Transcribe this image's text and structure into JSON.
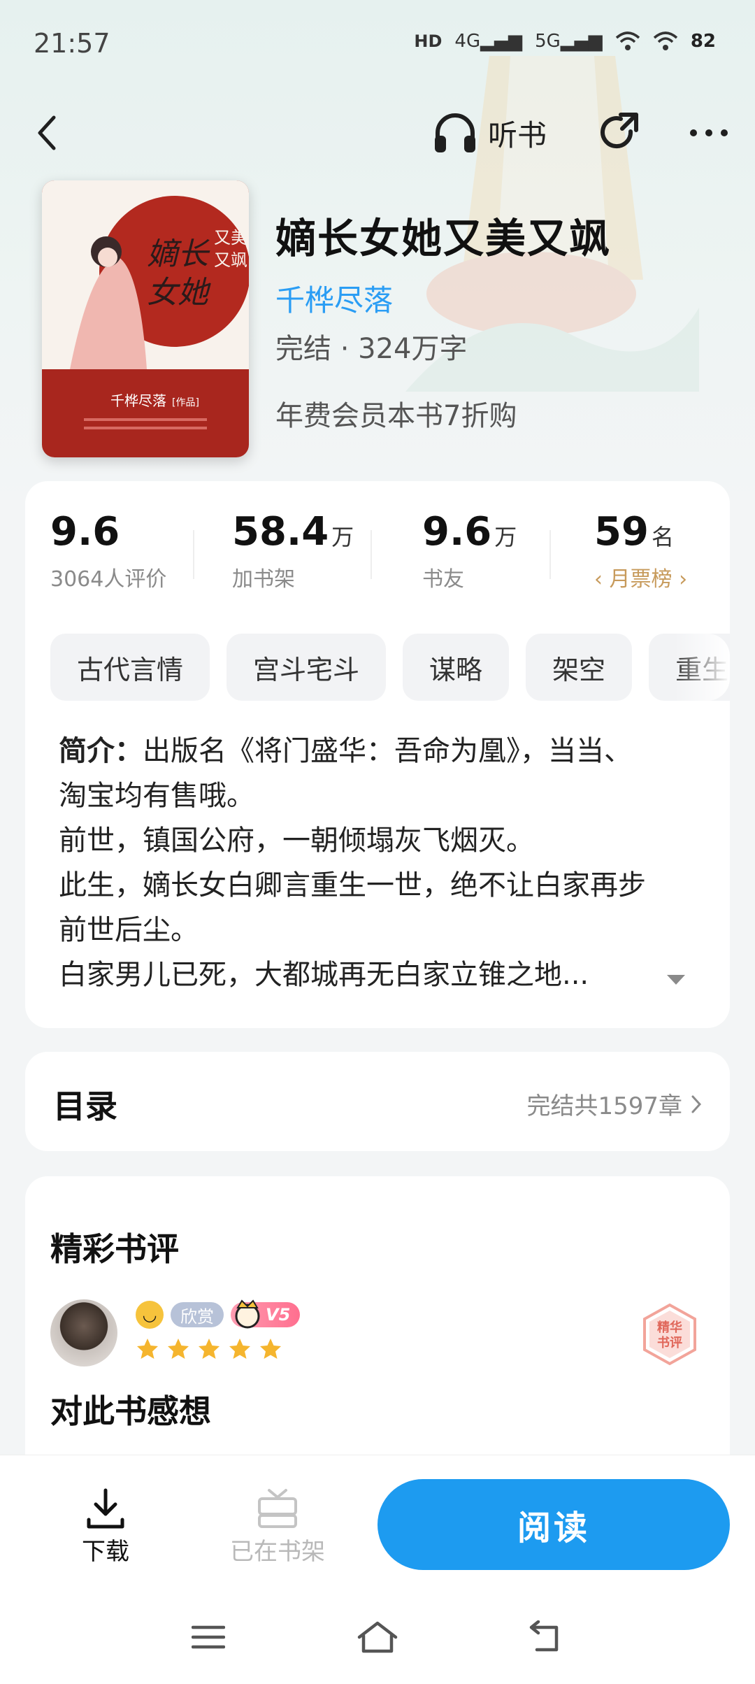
{
  "status_bar": {
    "time": "21:57",
    "hd_label": "HD",
    "net1": "4G",
    "net2": "5G",
    "battery": "82"
  },
  "nav": {
    "listen_label": "听书"
  },
  "book": {
    "title": "嫡长女她又美又飒",
    "author": "千桦尽落",
    "status": "完结 · 324万字",
    "offer": "年费会员本书7折购",
    "cover": {
      "title_art": "嫡长女她又美又飒",
      "author": "千桦尽落",
      "author_suffix": "作品"
    }
  },
  "stats": [
    {
      "num": "9.6",
      "unit": "",
      "label": "3064人评价"
    },
    {
      "num": "58.4",
      "unit": "万",
      "label": "加书架"
    },
    {
      "num": "9.6",
      "unit": "万",
      "label": "书友"
    },
    {
      "num": "59",
      "unit": "名",
      "label": "月票榜"
    }
  ],
  "tags": [
    "古代言情",
    "宫斗宅斗",
    "谋略",
    "架空",
    "重生"
  ],
  "intro": {
    "label": "简介：",
    "lines": [
      "出版名《将门盛华：吾命为凰》，当当、",
      "淘宝均有售哦。",
      "前世，镇国公府，一朝倾塌灰飞烟灭。",
      "此生，嫡长女白卿言重生一世，绝不让白家再步",
      "前世后尘。",
      "白家男儿已死，大都城再无白家立锥之地..."
    ]
  },
  "toc": {
    "title": "目录",
    "meta": "完结共1597章"
  },
  "review": {
    "section_title": "精彩书评",
    "badge": "欣赏",
    "vip": "V5",
    "stars": 5,
    "stamp_text": "精华书评",
    "heading": "对此书感想"
  },
  "bottom": {
    "download": "下载",
    "shelf": "已在书架",
    "read": "阅读"
  },
  "colors": {
    "accent": "#1d9bf0",
    "author_link": "#2a9df4",
    "rank": "#c79a5b",
    "star": "#f5b52e"
  }
}
